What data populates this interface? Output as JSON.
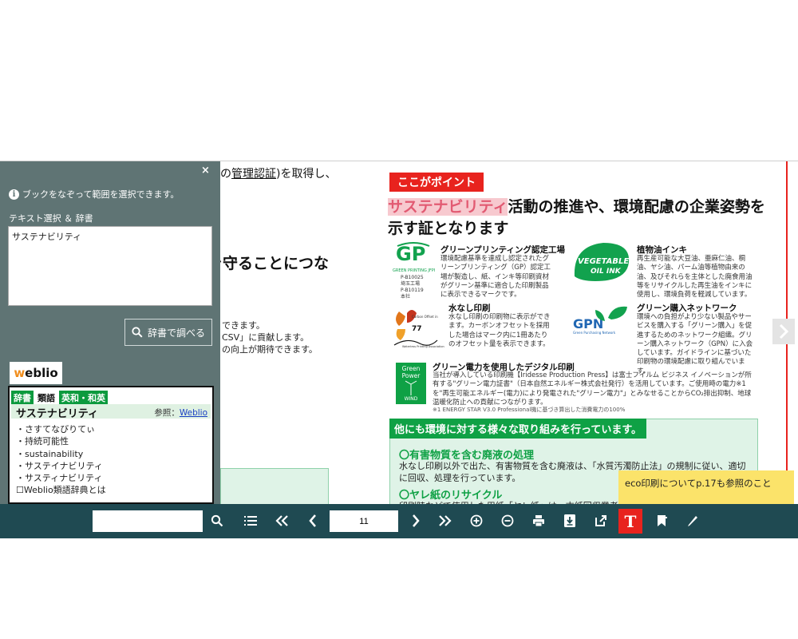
{
  "left_page": {
    "line1_prefix": "の",
    "line1_term": "管理認証",
    "line1_suffix": ")を取得し、",
    "big_heading": "を守ることにつな",
    "line2": "できます。",
    "line3": "CSV」に貢献します。",
    "line4": "の向上が期待できます。"
  },
  "right_page": {
    "point_badge": "ここがポイント",
    "headline_highlight": "サステナビリティ",
    "headline_rest_1": "活動の推進や、環境配慮の企業姿勢を",
    "headline_line2": "示す証となります",
    "certs": [
      {
        "title": "グリーンプリンティング認定工場",
        "desc": "環境配慮基準を達成し認定されたグリーンプリンティング（GP）認定工場が製造し、紙、インキ等印刷資材がグリーン基準に適合した印刷製品に表示できるマークです。",
        "logo_text": "GP",
        "logo_small": "GREEN PRINTING JFPI",
        "logo_ids": "P-B10025\n埼玉工場\nP-B10119\n本社"
      },
      {
        "title": "植物油インキ",
        "desc": "再生産可能な大豆油、亜麻仁油、桐油、ヤシ油、パーム油等植物由来の油、及びそれらを主体とした廃食用油等をリサイクルした再生油をインキに使用し、環境負荷を軽減しています。",
        "logo_line1": "VEGETABLE",
        "logo_line2": "OIL INK"
      },
      {
        "title": "水なし印刷",
        "desc": "水なし印刷の印刷物に表示ができます。カーボンオフセットを採用した場合はマーク内に1冊あたりのオフセット量を表示できます。",
        "logo_small": "Carbon Offset in",
        "logo_num": "77",
        "logo_sig": "Waterless Printing Association"
      },
      {
        "title": "グリーン購入ネットワーク",
        "desc": "環境への負担がより少ない製品やサービスを購入する「グリーン購入」を促進するためのネットワーク組織。グリーン購入ネットワーク（GPN）に入会しています。ガイドラインに基づいた印刷物の環境配慮に取り組んでいます。",
        "logo_text": "GPN",
        "logo_small": "Green Purchasing Network"
      },
      {
        "title": "グリーン電力を使用したデジタル印刷",
        "desc": "当社が導入している印刷機【Iridesse Production Press】は富士フイルム ビジネス イノベーションが所有する\"グリーン電力証書\"（日本自然エネルギー株式会社発行）を活用しています。ご使用時の電力※1を\"再生可能エネルギー(電力)により発電された\"グリーン電力\"」とみなせることからCO₂排出抑制、地球温暖化防止への貢献につながります。",
        "logo_line1": "Green",
        "logo_line2": "Power",
        "logo_line3": "WIND",
        "note": "※1 ENERGY STAR V3.0 Professional機に基づき算出した消費電力の100%"
      }
    ],
    "section_head": "他にも環境に対する様々な取り組みを行っています。",
    "sub1_title": "〇有害物質を含む廃液の処理",
    "sub1_text": "水なし印刷以外で出た、有害物質を含む廃液は、「水質汚濁防止法」の規制に従い、適切に回収、処理を行っています。",
    "sub2_title": "〇ヤレ紙のリサイクル",
    "sub2_text": "印刷時などで使用した用紙「ヤレ紙」は、古紙回収業者に"
  },
  "panel": {
    "close_label": "×",
    "info_text": "ブックをなぞって範囲を選択できます。",
    "selection_label": "テキスト選択 ＆ 辞書",
    "selection_value": "サステナビリティ",
    "dict_button": "辞書で調べる",
    "weblio_logo_w": "w",
    "weblio_logo_rest": "eblio",
    "tabs": [
      "辞書",
      "類語",
      "英和・和英"
    ],
    "entry_title": "サステナビリティ",
    "ref_label": "参照：",
    "ref_link": "Weblio",
    "results": [
      "・さすてなびりてぃ",
      "・持続可能性",
      "・sustainability",
      "・サステイナビリティ",
      "・サスティナビリティ",
      "☐Weblio類語辞典とは"
    ]
  },
  "tooltip_text": "eco印刷についてp.17も参照のこと",
  "toolbar": {
    "search_value": "",
    "page_number": "11"
  },
  "colors": {
    "toolbar_bg": "#1f4a52",
    "panel_bg": "#5f7474",
    "accent_red": "#e8231e",
    "eco_green": "#0fa145",
    "tooltip_yellow": "#fbe36a"
  }
}
